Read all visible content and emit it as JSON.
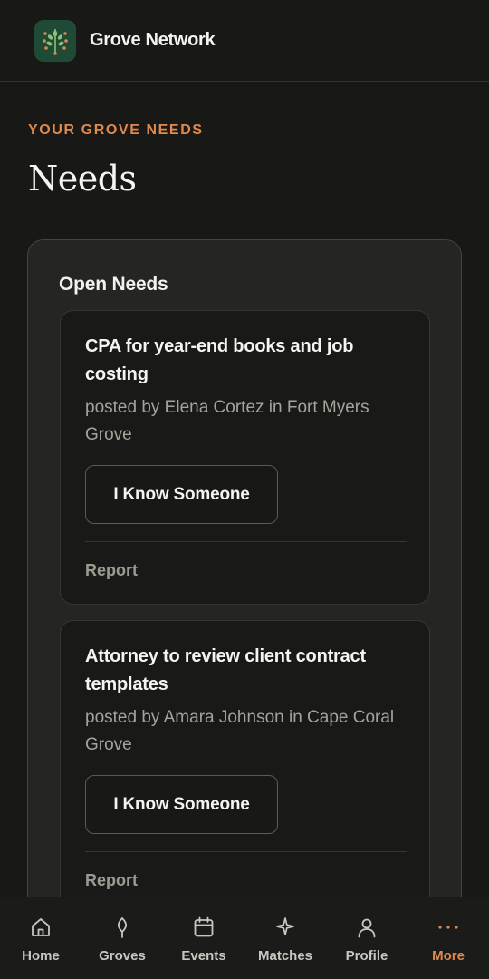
{
  "header": {
    "brand": "Grove Network",
    "logo_icon": "tree-logo-icon",
    "logo_bg": "#1f4a35"
  },
  "page": {
    "eyebrow": "YOUR GROVE NEEDS",
    "title": "Needs"
  },
  "panel": {
    "title": "Open Needs",
    "needs": [
      {
        "title": "CPA for year-end books and job costing",
        "meta": "posted by Elena Cortez in Fort Myers Grove",
        "button_label": "I Know Someone",
        "report_label": "Report"
      },
      {
        "title": "Attorney to review client contract templates",
        "meta": "posted by Amara Johnson in Cape Coral Grove",
        "button_label": "I Know Someone",
        "report_label": "Report"
      }
    ]
  },
  "nav": {
    "items": [
      {
        "label": "Home",
        "icon": "home-icon"
      },
      {
        "label": "Groves",
        "icon": "leaf-icon"
      },
      {
        "label": "Events",
        "icon": "calendar-icon"
      },
      {
        "label": "Matches",
        "icon": "sparkle-icon"
      },
      {
        "label": "Profile",
        "icon": "user-icon"
      },
      {
        "label": "More",
        "icon": "more-dots-icon",
        "active": true
      }
    ]
  },
  "colors": {
    "accent": "#e0894e",
    "background": "#181816",
    "panel": "#252523",
    "card": "#191917"
  }
}
